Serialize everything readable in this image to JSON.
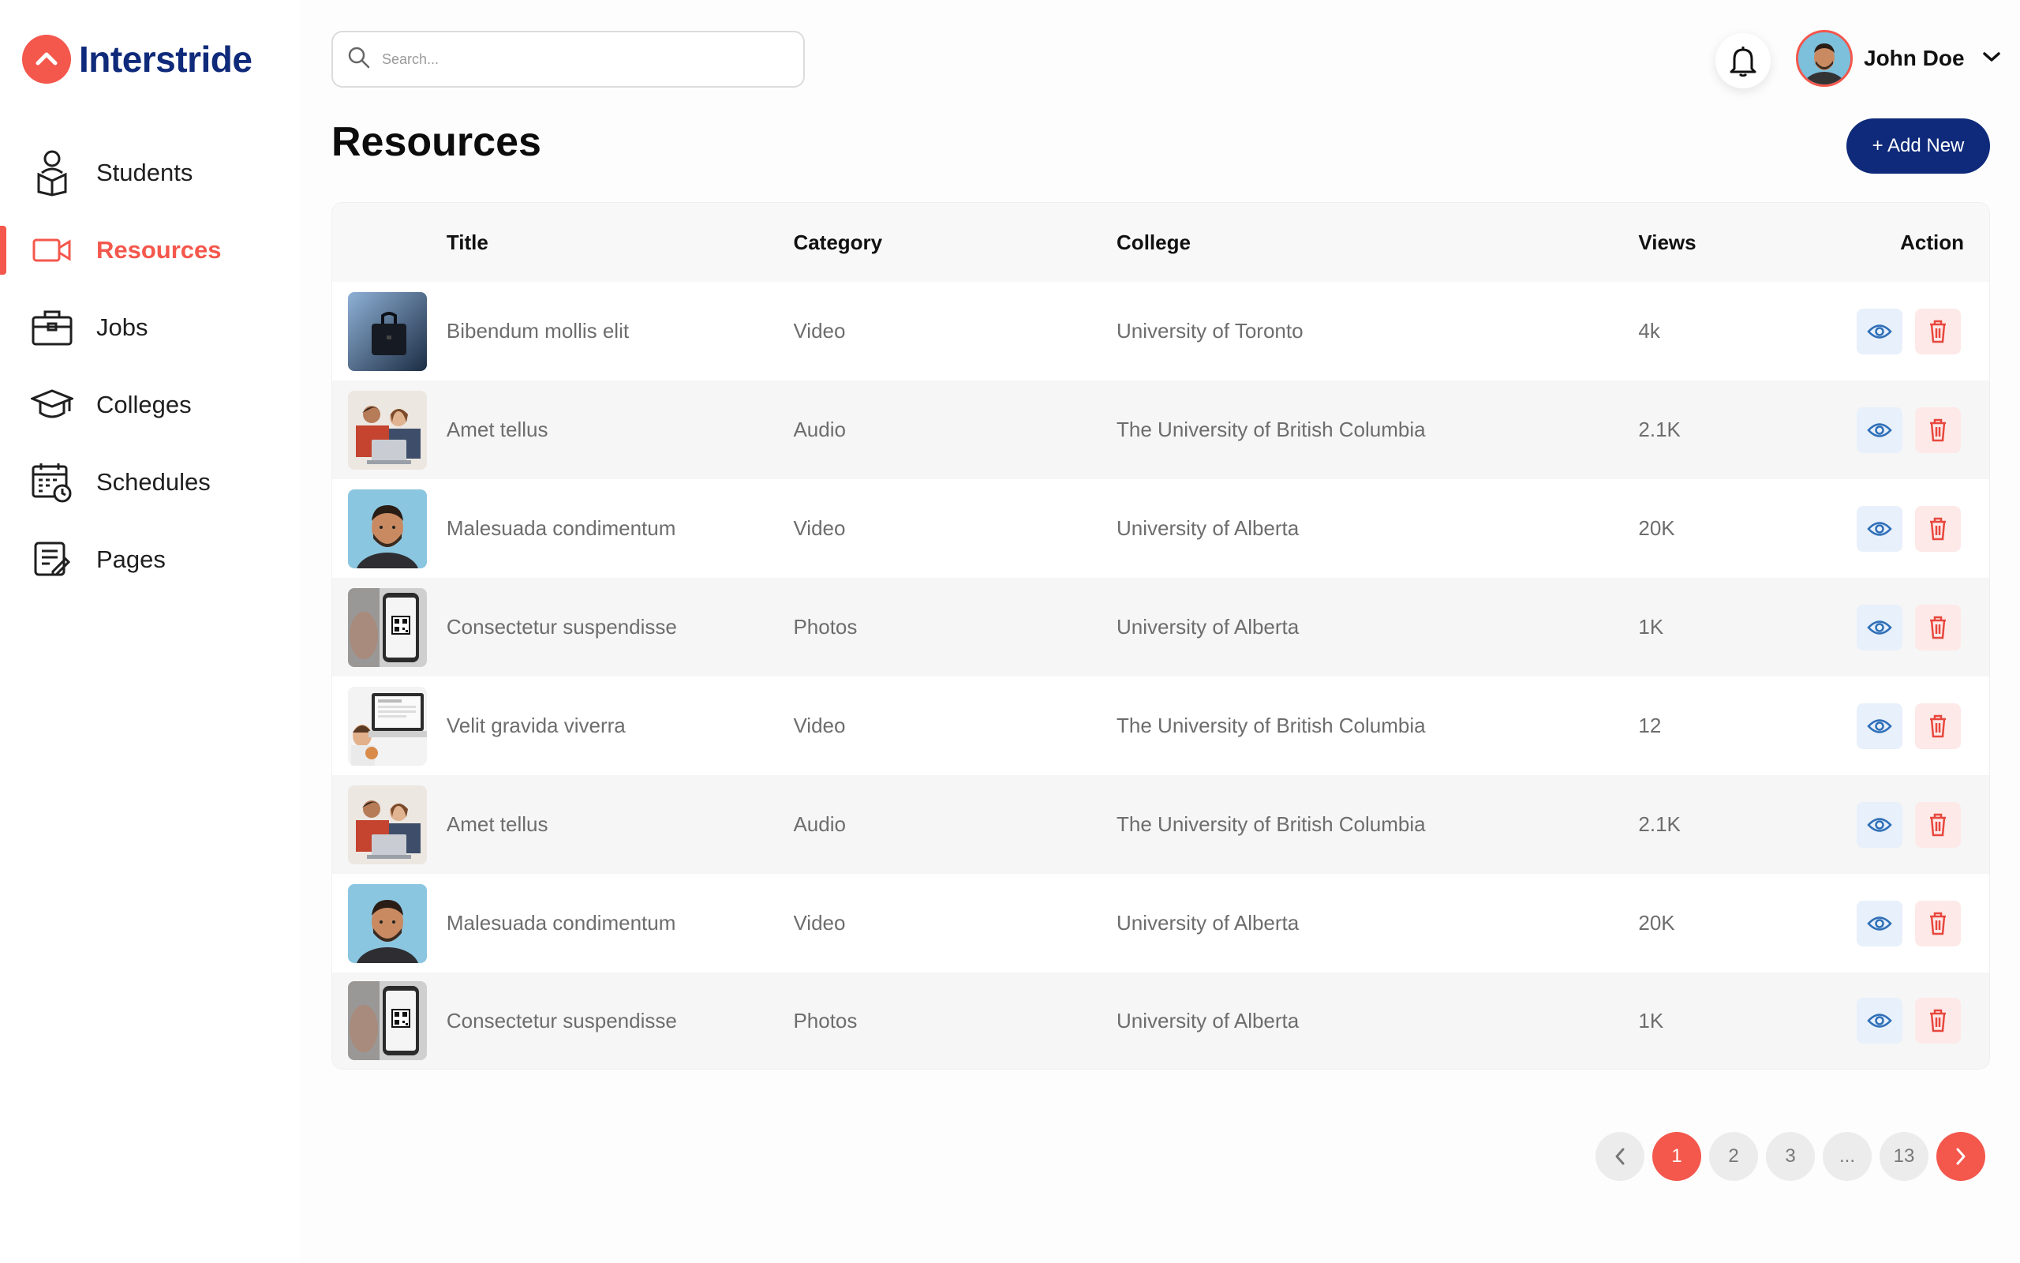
{
  "brand": {
    "name": "Interstride",
    "accent": "#f4574c",
    "navy": "#0f2a7a"
  },
  "sidebar": {
    "items": [
      {
        "label": "Students",
        "icon": "student-icon",
        "active": false
      },
      {
        "label": "Resources",
        "icon": "video-camera-icon",
        "active": true
      },
      {
        "label": "Jobs",
        "icon": "briefcase-icon",
        "active": false
      },
      {
        "label": "Colleges",
        "icon": "graduation-cap-icon",
        "active": false
      },
      {
        "label": "Schedules",
        "icon": "calendar-clock-icon",
        "active": false
      },
      {
        "label": "Pages",
        "icon": "document-edit-icon",
        "active": false
      }
    ]
  },
  "header": {
    "search_placeholder": "Search...",
    "user_name": "John Doe"
  },
  "page": {
    "title": "Resources",
    "add_button": "+ Add New"
  },
  "table": {
    "columns": {
      "title": "Title",
      "category": "Category",
      "college": "College",
      "views": "Views",
      "action": "Action"
    },
    "rows": [
      {
        "title": "Bibendum mollis elit",
        "category": "Video",
        "college": "University of Toronto",
        "views": "4k",
        "thumb": "briefcase-photo"
      },
      {
        "title": "Amet tellus",
        "category": "Audio",
        "college": "The University of British Columbia",
        "views": "2.1K",
        "thumb": "group-laptop-photo"
      },
      {
        "title": "Malesuada condimentum",
        "category": "Video",
        "college": "University of Alberta",
        "views": "20K",
        "thumb": "man-portrait-photo"
      },
      {
        "title": "Consectetur suspendisse",
        "category": "Photos",
        "college": "University of Alberta",
        "views": "1K",
        "thumb": "phone-qr-photo"
      },
      {
        "title": "Velit gravida viverra",
        "category": "Video",
        "college": "The University of British Columbia",
        "views": "12",
        "thumb": "laptop-desk-photo"
      },
      {
        "title": "Amet tellus",
        "category": "Audio",
        "college": "The University of British Columbia",
        "views": "2.1K",
        "thumb": "group-laptop-photo"
      },
      {
        "title": "Malesuada condimentum",
        "category": "Video",
        "college": "University of Alberta",
        "views": "20K",
        "thumb": "man-portrait-photo"
      },
      {
        "title": "Consectetur suspendisse",
        "category": "Photos",
        "college": "University of Alberta",
        "views": "1K",
        "thumb": "phone-qr-photo"
      }
    ]
  },
  "pagination": {
    "pages": [
      "1",
      "2",
      "3",
      "...",
      "13"
    ],
    "current": "1"
  }
}
